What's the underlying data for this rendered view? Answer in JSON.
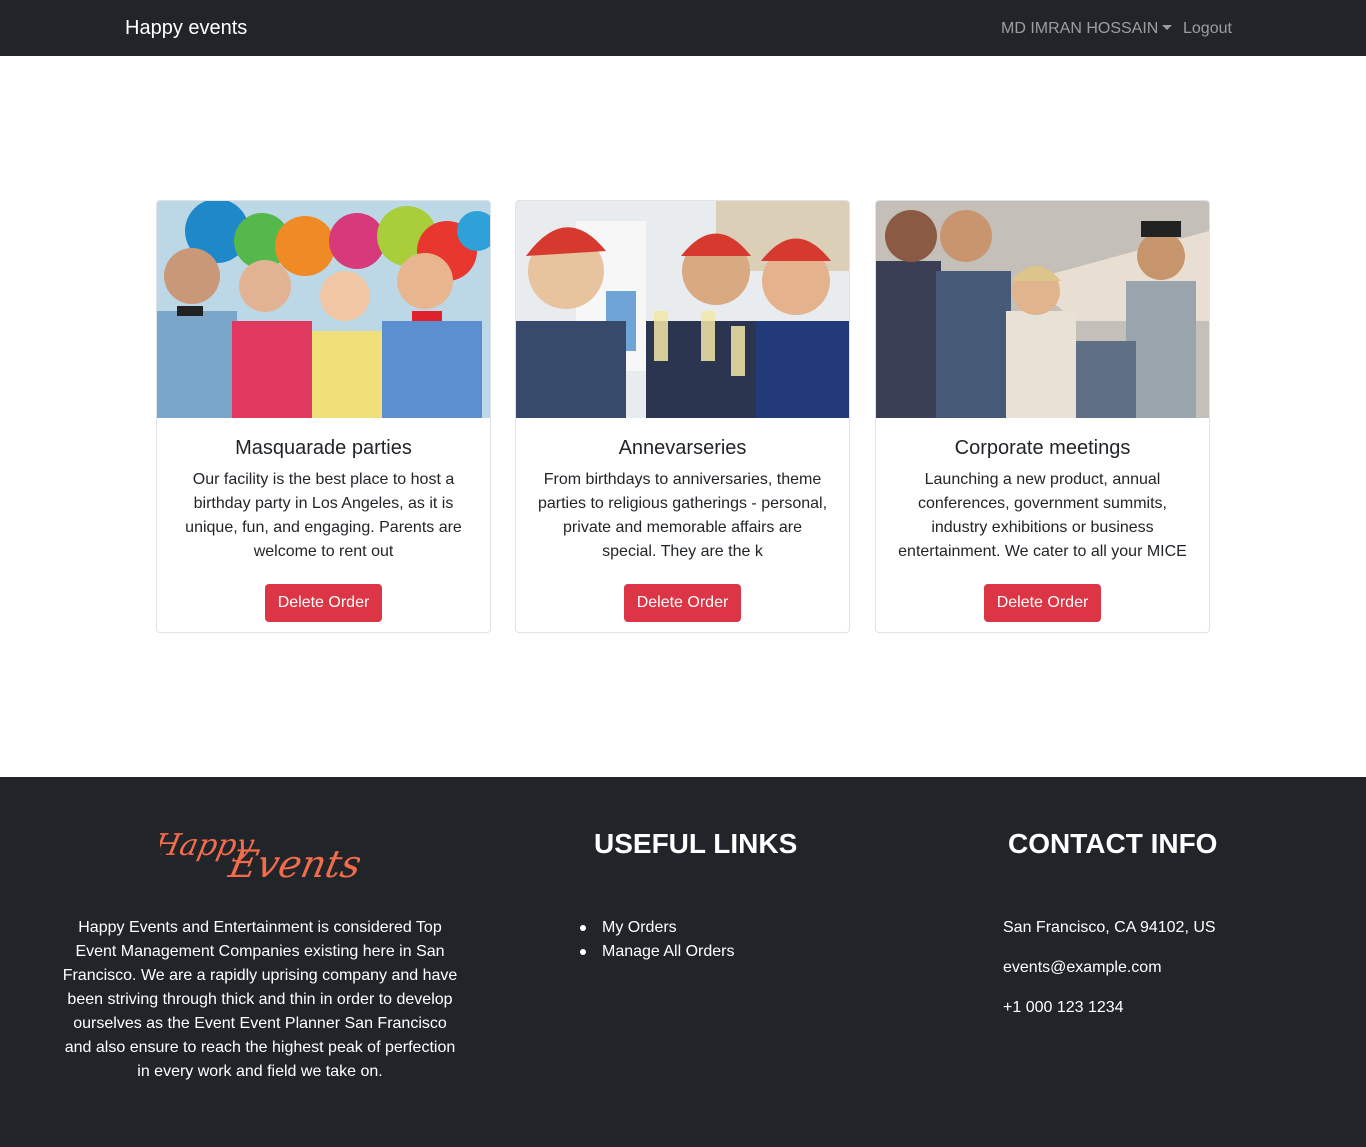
{
  "navbar": {
    "brand": "Happy events",
    "user": "MD IMRAN HOSSAIN",
    "logout": "Logout"
  },
  "cards": [
    {
      "title": "Masquarade parties",
      "text": "Our facility is the best place to host a birthday party in Los Angeles, as it is unique, fun, and engaging. Parents are welcome to rent out",
      "button": "Delete Order"
    },
    {
      "title": "Annevarseries",
      "text": "From birthdays to anniversaries, theme parties to religious gatherings - personal, private and memorable affairs are special. They are the k",
      "button": "Delete Order"
    },
    {
      "title": "Corporate meetings",
      "text": "Launching a new product, annual conferences, government summits, industry exhibitions or business entertainment. We cater to all your MICE n",
      "button": "Delete Order"
    }
  ],
  "footer": {
    "logo_text": "Happy Events",
    "about": "Happy Events and Entertainment is considered Top Event Management Companies existing here in San Francisco. We are a rapidly uprising company and have been striving through thick and thin in order to develop ourselves as the Event Event Planner San Francisco and also ensure to reach the highest peak of perfection in every work and field we take on.",
    "links_title": "USEFUL LINKS",
    "links": [
      "My Orders",
      "Manage All Orders"
    ],
    "contact_title": "CONTACT INFO",
    "address": "San Francisco, CA 94102, US",
    "email": "events@example.com",
    "phone": "+1 000 123 1234"
  },
  "colors": {
    "dark": "#212529",
    "danger": "#dc3545",
    "logo": "#f26b4b"
  }
}
